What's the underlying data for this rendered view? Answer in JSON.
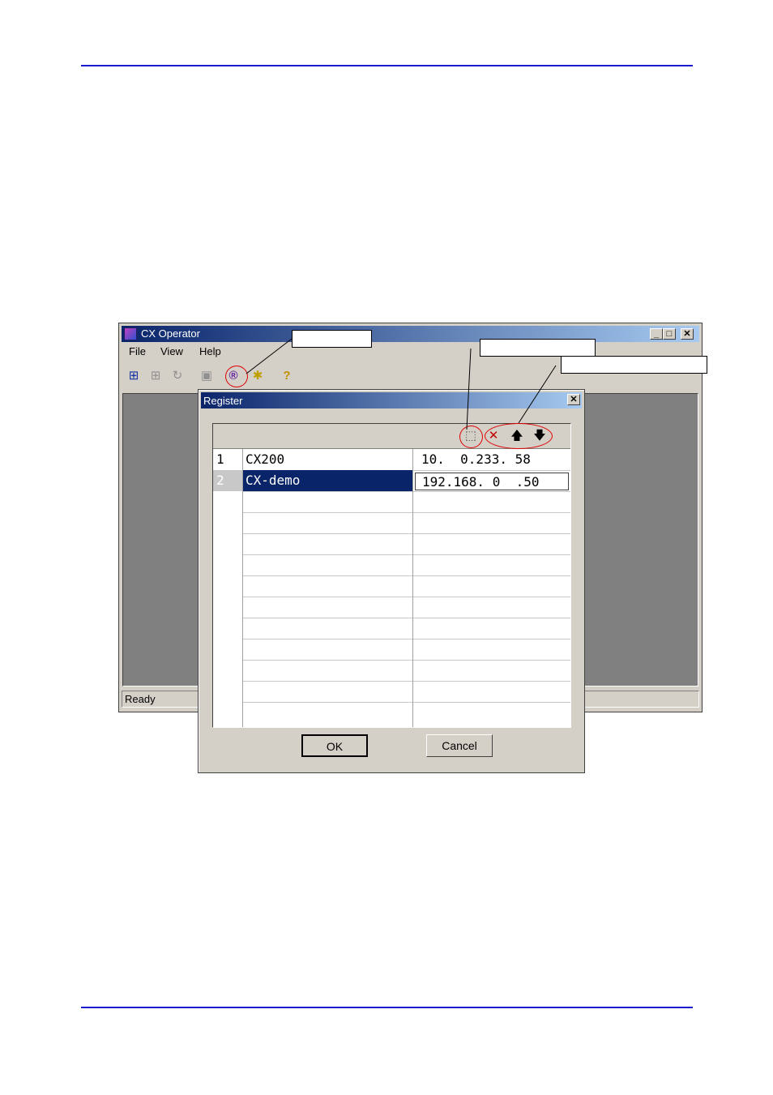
{
  "main_window": {
    "title": "CX Operator",
    "menu": [
      "File",
      "View",
      "Help"
    ],
    "status": "Ready"
  },
  "register_dialog": {
    "title": "Register",
    "rows": [
      {
        "num": "1",
        "name": "CX200",
        "ip": "10.  0.233. 58"
      },
      {
        "num": "2",
        "name": "CX-demo",
        "ip": "192.168. 0  .50"
      }
    ],
    "ok_label": "OK",
    "cancel_label": "Cancel"
  },
  "colors": {
    "rule": "#1a1ad0",
    "title_active": "#0a246a",
    "selection": "#0a246a",
    "annotation": "#e00000"
  },
  "icons": [
    "new-row-icon",
    "delete-row-icon",
    "move-up-icon",
    "move-down-icon",
    "register-icon",
    "connect-icon",
    "disconnect-icon",
    "refresh-icon",
    "help-icon"
  ]
}
